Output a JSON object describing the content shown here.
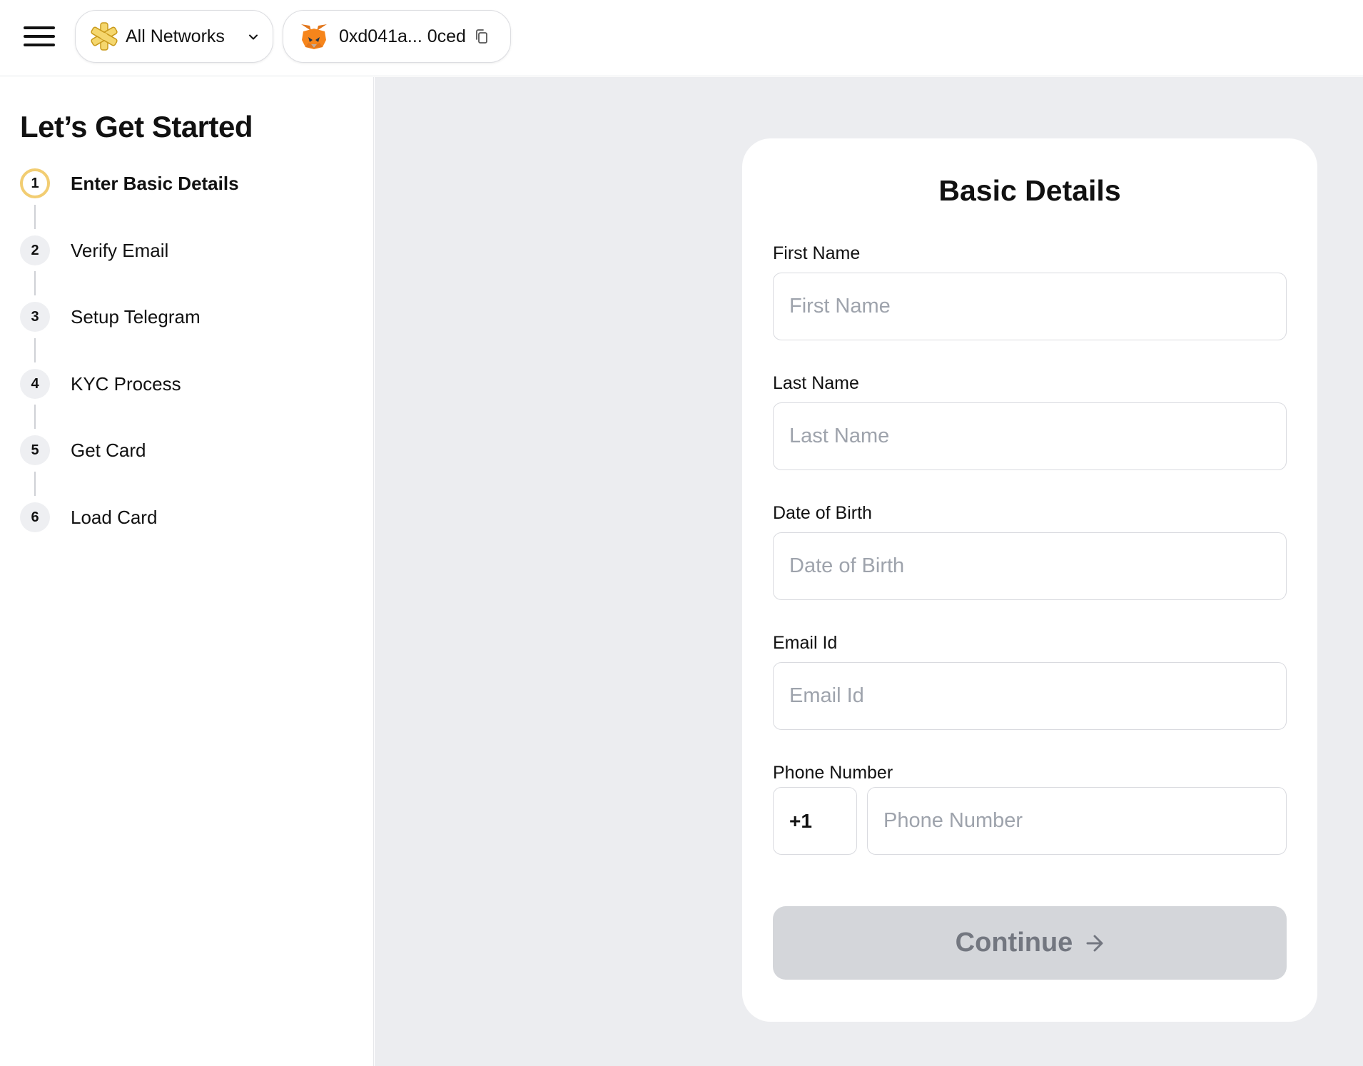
{
  "header": {
    "network_label": "All Networks",
    "wallet_address": "0xd041a... 0ced"
  },
  "sidebar": {
    "title": "Let’s Get Started",
    "steps": [
      {
        "num": "1",
        "label": "Enter Basic Details",
        "active": true
      },
      {
        "num": "2",
        "label": "Verify Email",
        "active": false
      },
      {
        "num": "3",
        "label": "Setup Telegram",
        "active": false
      },
      {
        "num": "4",
        "label": "KYC Process",
        "active": false
      },
      {
        "num": "5",
        "label": "Get Card",
        "active": false
      },
      {
        "num": "6",
        "label": "Load Card",
        "active": false
      }
    ]
  },
  "form": {
    "title": "Basic Details",
    "first_name": {
      "label": "First Name",
      "placeholder": "First Name",
      "value": ""
    },
    "last_name": {
      "label": "Last Name",
      "placeholder": "Last Name",
      "value": ""
    },
    "dob": {
      "label": "Date of Birth",
      "placeholder": "Date of Birth",
      "value": ""
    },
    "email": {
      "label": "Email Id",
      "placeholder": "Email Id",
      "value": ""
    },
    "phone": {
      "label": "Phone Number",
      "country_code": "+1",
      "placeholder": "Phone Number",
      "value": ""
    },
    "continue_label": "Continue"
  },
  "colors": {
    "accent_step_ring": "#f2cd72",
    "page_bg": "#ecedf0",
    "button_disabled_bg": "#d4d6da",
    "button_disabled_text": "#737780"
  },
  "icons": {
    "menu": "hamburger-icon",
    "network": "all-networks-icon",
    "network_dropdown": "chevron-down-icon",
    "wallet": "metamask-fox-icon",
    "copy": "copy-icon",
    "continue": "arrow-right-icon"
  }
}
